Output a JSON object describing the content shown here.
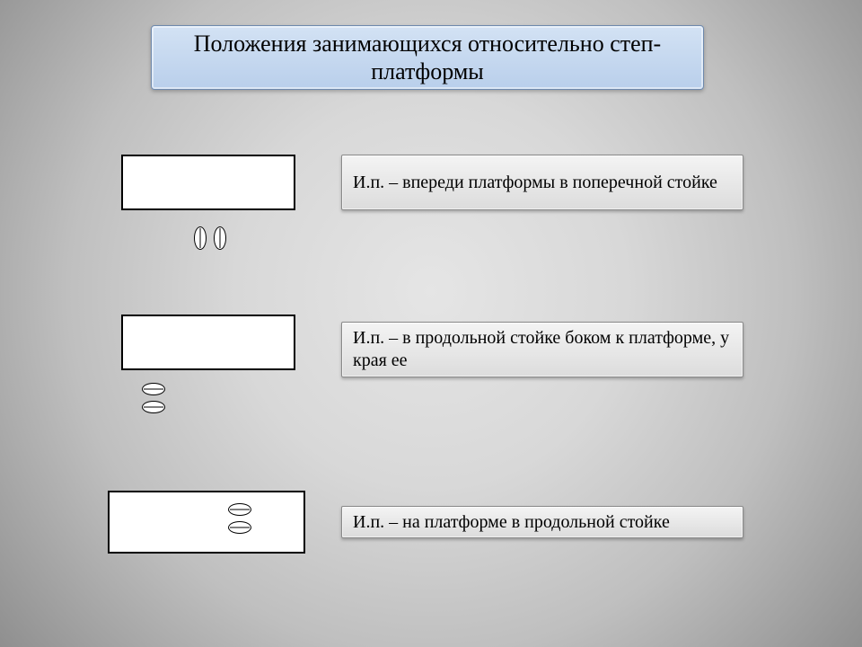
{
  "title": "Положения занимающихся относительно степ-платформы",
  "items": [
    {
      "desc": "И.п. – впереди платформы в поперечной стойке"
    },
    {
      "desc": "И.п. – в продольной стойке боком к платформе, у края ее"
    },
    {
      "desc": "И.п. – на платформе в продольной стойке"
    }
  ]
}
